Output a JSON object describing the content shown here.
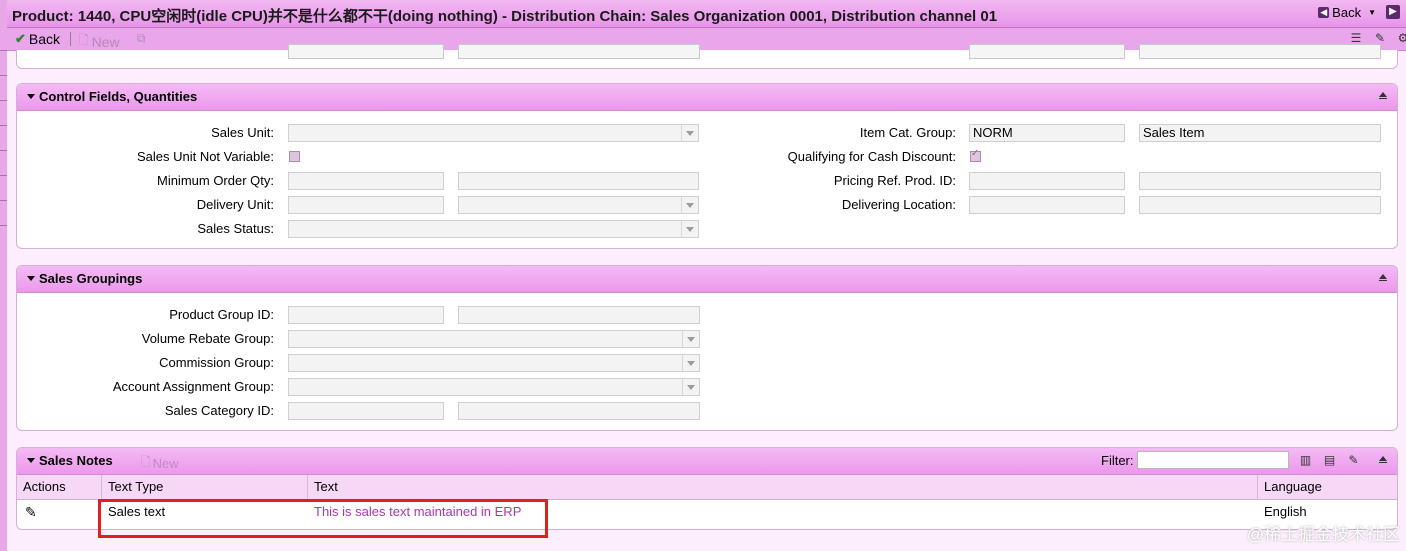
{
  "window": {
    "title": "Product: 1440, CPU空闲时(idle CPU)并不是什么都不干(doing nothing) - Distribution Chain: Sales Organization 0001, Distribution channel 01",
    "back_label": "Back"
  },
  "toolbar": {
    "back_label": "Back",
    "new_label": "New"
  },
  "control_fields": {
    "title": "Control Fields, Quantities",
    "sales_unit_label": "Sales Unit:",
    "sales_unit_not_variable_label": "Sales Unit Not Variable:",
    "minimum_order_qty_label": "Minimum Order Qty:",
    "delivery_unit_label": "Delivery Unit:",
    "sales_status_label": "Sales Status:",
    "item_cat_group_label": "Item Cat. Group:",
    "item_cat_group_value": "NORM",
    "item_cat_group_desc": "Sales Item",
    "qualifying_cash_discount_label": "Qualifying for Cash Discount:",
    "pricing_ref_prod_label": "Pricing Ref. Prod. ID:",
    "delivering_location_label": "Delivering Location:"
  },
  "sales_groupings": {
    "title": "Sales Groupings",
    "product_group_label": "Product Group ID:",
    "volume_rebate_label": "Volume Rebate Group:",
    "commission_group_label": "Commission Group:",
    "account_assignment_label": "Account Assignment Group:",
    "sales_category_label": "Sales Category ID:"
  },
  "sales_notes": {
    "title": "Sales Notes",
    "new_label": "New",
    "filter_label": "Filter:",
    "columns": {
      "actions": "Actions",
      "text_type": "Text Type",
      "text": "Text",
      "language": "Language"
    },
    "rows": [
      {
        "text_type": "Sales text",
        "text": "This is sales text maintained in ERP",
        "language": "English"
      }
    ]
  },
  "watermark": "@稀土掘金技术社区",
  "colors": {
    "header_accent": "#ec98ec",
    "link": "#b034b0",
    "highlight_box": "#e0201f"
  }
}
